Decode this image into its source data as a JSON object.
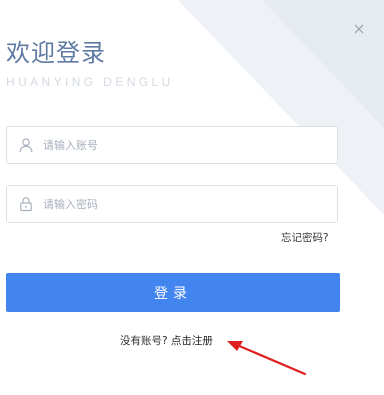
{
  "dialog": {
    "title": "欢迎登录",
    "subtitle": "HUANYING DENGLU",
    "close_glyph": "×"
  },
  "form": {
    "username": {
      "placeholder": "请输入账号",
      "value": "",
      "icon": "user-icon"
    },
    "password": {
      "placeholder": "请输入密码",
      "value": "",
      "icon": "lock-icon"
    },
    "forgot_password": "忘记密码?",
    "login_button": "登录"
  },
  "footer": {
    "no_account": "没有账号?",
    "register_link": "点击注册"
  },
  "colors": {
    "accent": "#4285ef",
    "title": "#5f7aa3",
    "annotation_arrow": "#e02020"
  }
}
